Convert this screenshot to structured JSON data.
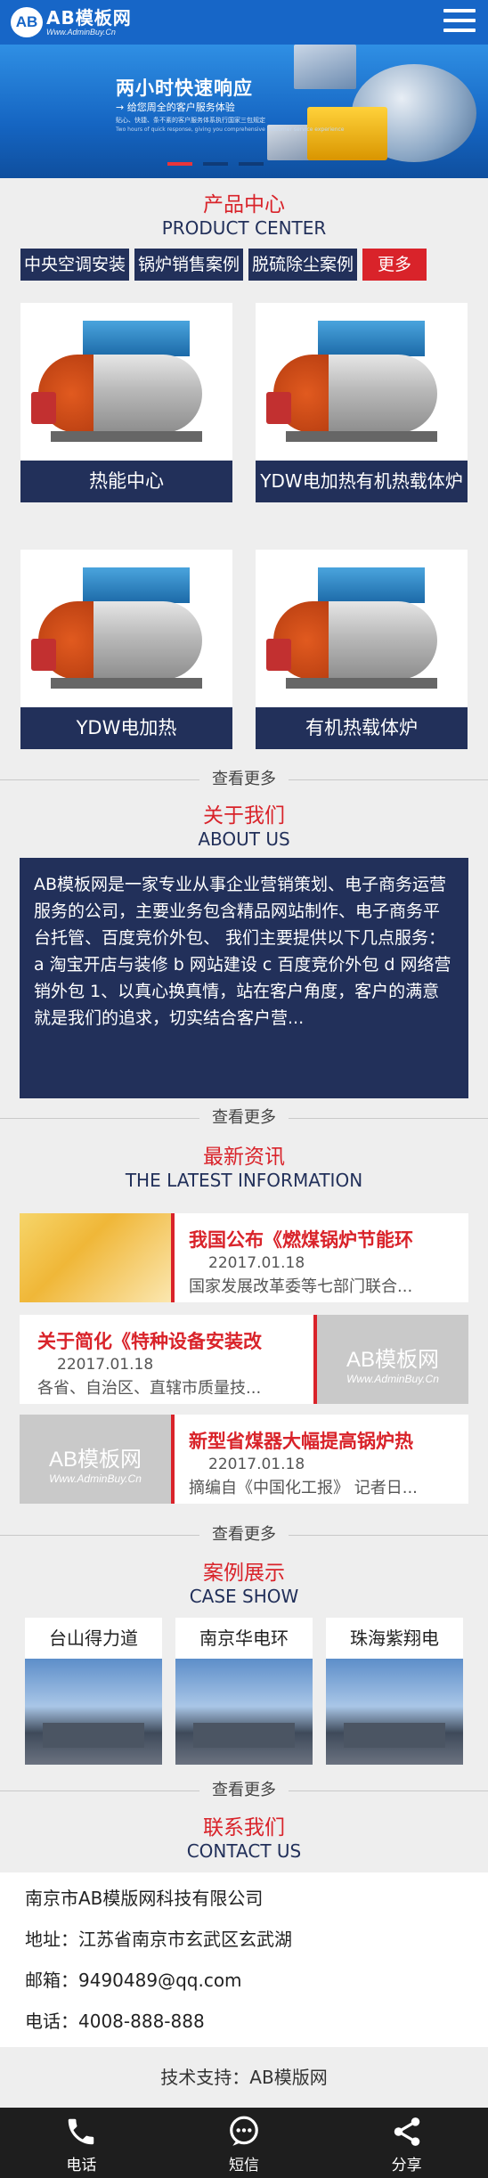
{
  "header": {
    "logo_mark": "AB",
    "logo_main": "AB模板网",
    "logo_sub": "Www.AdminBuy.Cn"
  },
  "banner": {
    "title": "两小时快速响应",
    "subtitle": "→ 给您周全的客户服务体验",
    "fine_print": "贴心、快捷、条不紊的客户服务体系执行国家三包规定",
    "fine_print_en": "Two hours of quick response, giving you comprehensive customer service experience"
  },
  "products": {
    "title_cn": "产品中心",
    "title_en": "PRODUCT CENTER",
    "tags": [
      "中央空调安装",
      "锅炉销售案例",
      "脱硫除尘案例"
    ],
    "more_tag": "更多",
    "items": [
      {
        "caption": "热能中心"
      },
      {
        "caption": "YDW电加热有机热载体炉"
      },
      {
        "caption": "YDW电加热"
      },
      {
        "caption": "有机热载体炉"
      }
    ],
    "view_more": "查看更多"
  },
  "about": {
    "title_cn": "关于我们",
    "title_en": "ABOUT US",
    "body": "AB模板网是一家专业从事企业营销策划、电子商务运营服务的公司，主要业务包含精品网站制作、电子商务平台托管、百度竞价外包、 我们主要提供以下几点服务： a 淘宝开店与装修 b 网站建设 c 百度竞价外包 d 网络营销外包 1、以真心换真情，站在客户角度，客户的满意就是我们的追求，切实结合客户营...",
    "view_more": "查看更多"
  },
  "news": {
    "title_cn": "最新资讯",
    "title_en": "THE LATEST INFORMATION",
    "items": [
      {
        "title": "我国公布《燃煤锅炉节能环",
        "date": "22017.01.18",
        "desc": "国家发展改革委等七部门联合..."
      },
      {
        "title": "关于简化《特种设备安装改",
        "date": "22017.01.18",
        "desc": "各省、自治区、直辖市质量技..."
      },
      {
        "title": "新型省煤器大幅提高锅炉热",
        "date": "22017.01.18",
        "desc": "摘编自《中国化工报》 记者日..."
      }
    ],
    "img_logo_main": "AB模板网",
    "img_logo_sub": "Www.AdminBuy.Cn",
    "view_more": "查看更多"
  },
  "cases": {
    "title_cn": "案例展示",
    "title_en": "CASE SHOW",
    "items": [
      {
        "title": "台山得力道"
      },
      {
        "title": "南京华电环"
      },
      {
        "title": "珠海紫翔电"
      }
    ],
    "view_more": "查看更多"
  },
  "contact": {
    "title_cn": "联系我们",
    "title_en": "CONTACT US",
    "company": "南京市AB模版网科技有限公司",
    "address": "地址：江苏省南京市玄武区玄武湖",
    "email": "邮箱：9490489@qq.com",
    "phone": "电话：4008-888-888"
  },
  "footer": {
    "support": "技术支持：AB模版网"
  },
  "bottom_nav": {
    "phone": "电话",
    "sms": "短信",
    "share": "分享"
  },
  "colors": {
    "brand_blue": "#1766c7",
    "navy": "#22305a",
    "accent_red": "#d9232a"
  }
}
